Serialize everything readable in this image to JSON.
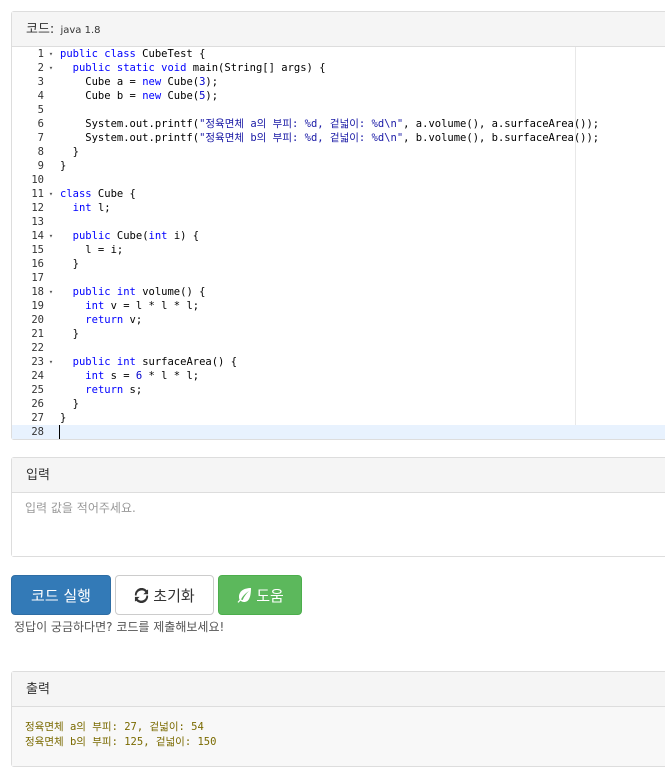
{
  "code_panel": {
    "title": "코드:",
    "language": "java 1.8",
    "fold_marker": "▾",
    "lines": [
      {
        "n": "1",
        "fold": true,
        "tokens": [
          {
            "t": "public class",
            "c": "kw"
          },
          {
            "t": " CubeTest {",
            "c": ""
          }
        ]
      },
      {
        "n": "2",
        "fold": true,
        "tokens": [
          {
            "t": "  ",
            "c": ""
          },
          {
            "t": "public static void",
            "c": "kw"
          },
          {
            "t": " main(String[] args) {",
            "c": ""
          }
        ]
      },
      {
        "n": "3",
        "fold": false,
        "tokens": [
          {
            "t": "    Cube a = ",
            "c": ""
          },
          {
            "t": "new",
            "c": "kw"
          },
          {
            "t": " Cube(",
            "c": ""
          },
          {
            "t": "3",
            "c": "num"
          },
          {
            "t": ");",
            "c": ""
          }
        ]
      },
      {
        "n": "4",
        "fold": false,
        "tokens": [
          {
            "t": "    Cube b = ",
            "c": ""
          },
          {
            "t": "new",
            "c": "kw"
          },
          {
            "t": " Cube(",
            "c": ""
          },
          {
            "t": "5",
            "c": "num"
          },
          {
            "t": ");",
            "c": ""
          }
        ]
      },
      {
        "n": "5",
        "fold": false,
        "tokens": []
      },
      {
        "n": "6",
        "fold": false,
        "tokens": [
          {
            "t": "    System.out.printf(",
            "c": ""
          },
          {
            "t": "\"정육면체 a의 부피: %d, 겉넓이: %d\\n\"",
            "c": "str"
          },
          {
            "t": ", a.volume(), a.surfaceArea());",
            "c": ""
          }
        ]
      },
      {
        "n": "7",
        "fold": false,
        "tokens": [
          {
            "t": "    System.out.printf(",
            "c": ""
          },
          {
            "t": "\"정육면체 b의 부피: %d, 겉넓이: %d\\n\"",
            "c": "str"
          },
          {
            "t": ", b.volume(), b.surfaceArea());",
            "c": ""
          }
        ]
      },
      {
        "n": "8",
        "fold": false,
        "tokens": [
          {
            "t": "  }",
            "c": ""
          }
        ]
      },
      {
        "n": "9",
        "fold": false,
        "tokens": [
          {
            "t": "}",
            "c": ""
          }
        ]
      },
      {
        "n": "10",
        "fold": false,
        "tokens": []
      },
      {
        "n": "11",
        "fold": true,
        "tokens": [
          {
            "t": "class",
            "c": "kw"
          },
          {
            "t": " Cube {",
            "c": ""
          }
        ]
      },
      {
        "n": "12",
        "fold": false,
        "tokens": [
          {
            "t": "  ",
            "c": ""
          },
          {
            "t": "int",
            "c": "kw"
          },
          {
            "t": " l;",
            "c": ""
          }
        ]
      },
      {
        "n": "13",
        "fold": false,
        "tokens": []
      },
      {
        "n": "14",
        "fold": true,
        "tokens": [
          {
            "t": "  ",
            "c": ""
          },
          {
            "t": "public",
            "c": "kw"
          },
          {
            "t": " Cube(",
            "c": ""
          },
          {
            "t": "int",
            "c": "kw"
          },
          {
            "t": " i) {",
            "c": ""
          }
        ]
      },
      {
        "n": "15",
        "fold": false,
        "tokens": [
          {
            "t": "    l = i;",
            "c": ""
          }
        ]
      },
      {
        "n": "16",
        "fold": false,
        "tokens": [
          {
            "t": "  }",
            "c": ""
          }
        ]
      },
      {
        "n": "17",
        "fold": false,
        "tokens": []
      },
      {
        "n": "18",
        "fold": true,
        "tokens": [
          {
            "t": "  ",
            "c": ""
          },
          {
            "t": "public int",
            "c": "kw"
          },
          {
            "t": " volume() {",
            "c": ""
          }
        ]
      },
      {
        "n": "19",
        "fold": false,
        "tokens": [
          {
            "t": "    ",
            "c": ""
          },
          {
            "t": "int",
            "c": "kw"
          },
          {
            "t": " v = l * l * l;",
            "c": ""
          }
        ]
      },
      {
        "n": "20",
        "fold": false,
        "tokens": [
          {
            "t": "    ",
            "c": ""
          },
          {
            "t": "return",
            "c": "kw"
          },
          {
            "t": " v;",
            "c": ""
          }
        ]
      },
      {
        "n": "21",
        "fold": false,
        "tokens": [
          {
            "t": "  }",
            "c": ""
          }
        ]
      },
      {
        "n": "22",
        "fold": false,
        "tokens": []
      },
      {
        "n": "23",
        "fold": true,
        "tokens": [
          {
            "t": "  ",
            "c": ""
          },
          {
            "t": "public int",
            "c": "kw"
          },
          {
            "t": " surfaceArea() {",
            "c": ""
          }
        ]
      },
      {
        "n": "24",
        "fold": false,
        "tokens": [
          {
            "t": "    ",
            "c": ""
          },
          {
            "t": "int",
            "c": "kw"
          },
          {
            "t": " s = ",
            "c": ""
          },
          {
            "t": "6",
            "c": "num"
          },
          {
            "t": " * l * l;",
            "c": ""
          }
        ]
      },
      {
        "n": "25",
        "fold": false,
        "tokens": [
          {
            "t": "    ",
            "c": ""
          },
          {
            "t": "return",
            "c": "kw"
          },
          {
            "t": " s;",
            "c": ""
          }
        ]
      },
      {
        "n": "26",
        "fold": false,
        "tokens": [
          {
            "t": "  }",
            "c": ""
          }
        ]
      },
      {
        "n": "27",
        "fold": false,
        "tokens": [
          {
            "t": "}",
            "c": ""
          }
        ]
      },
      {
        "n": "28",
        "fold": false,
        "active": true,
        "tokens": []
      }
    ]
  },
  "input_panel": {
    "title": "입력",
    "placeholder": "입력 값을 적어주세요.",
    "value": ""
  },
  "buttons": {
    "run_label": "코드 실행",
    "reset_label": "초기화",
    "reset_icon": "refresh-icon",
    "help_label": "도움",
    "help_icon": "leaf-icon"
  },
  "hint": "정답이 궁금하다면? 코드를 제출해보세요!",
  "output_panel": {
    "title": "출력",
    "lines": [
      "정육면체 a의 부피: 27, 겉넓이: 54",
      "정육면체 b의 부피: 125, 겉넓이: 150"
    ]
  },
  "colors": {
    "run_button": "#337ab7",
    "help_button": "#5cb85c",
    "keyword": "#0000ff",
    "string": "#1a1aa6",
    "output_text": "#7a6a00"
  }
}
